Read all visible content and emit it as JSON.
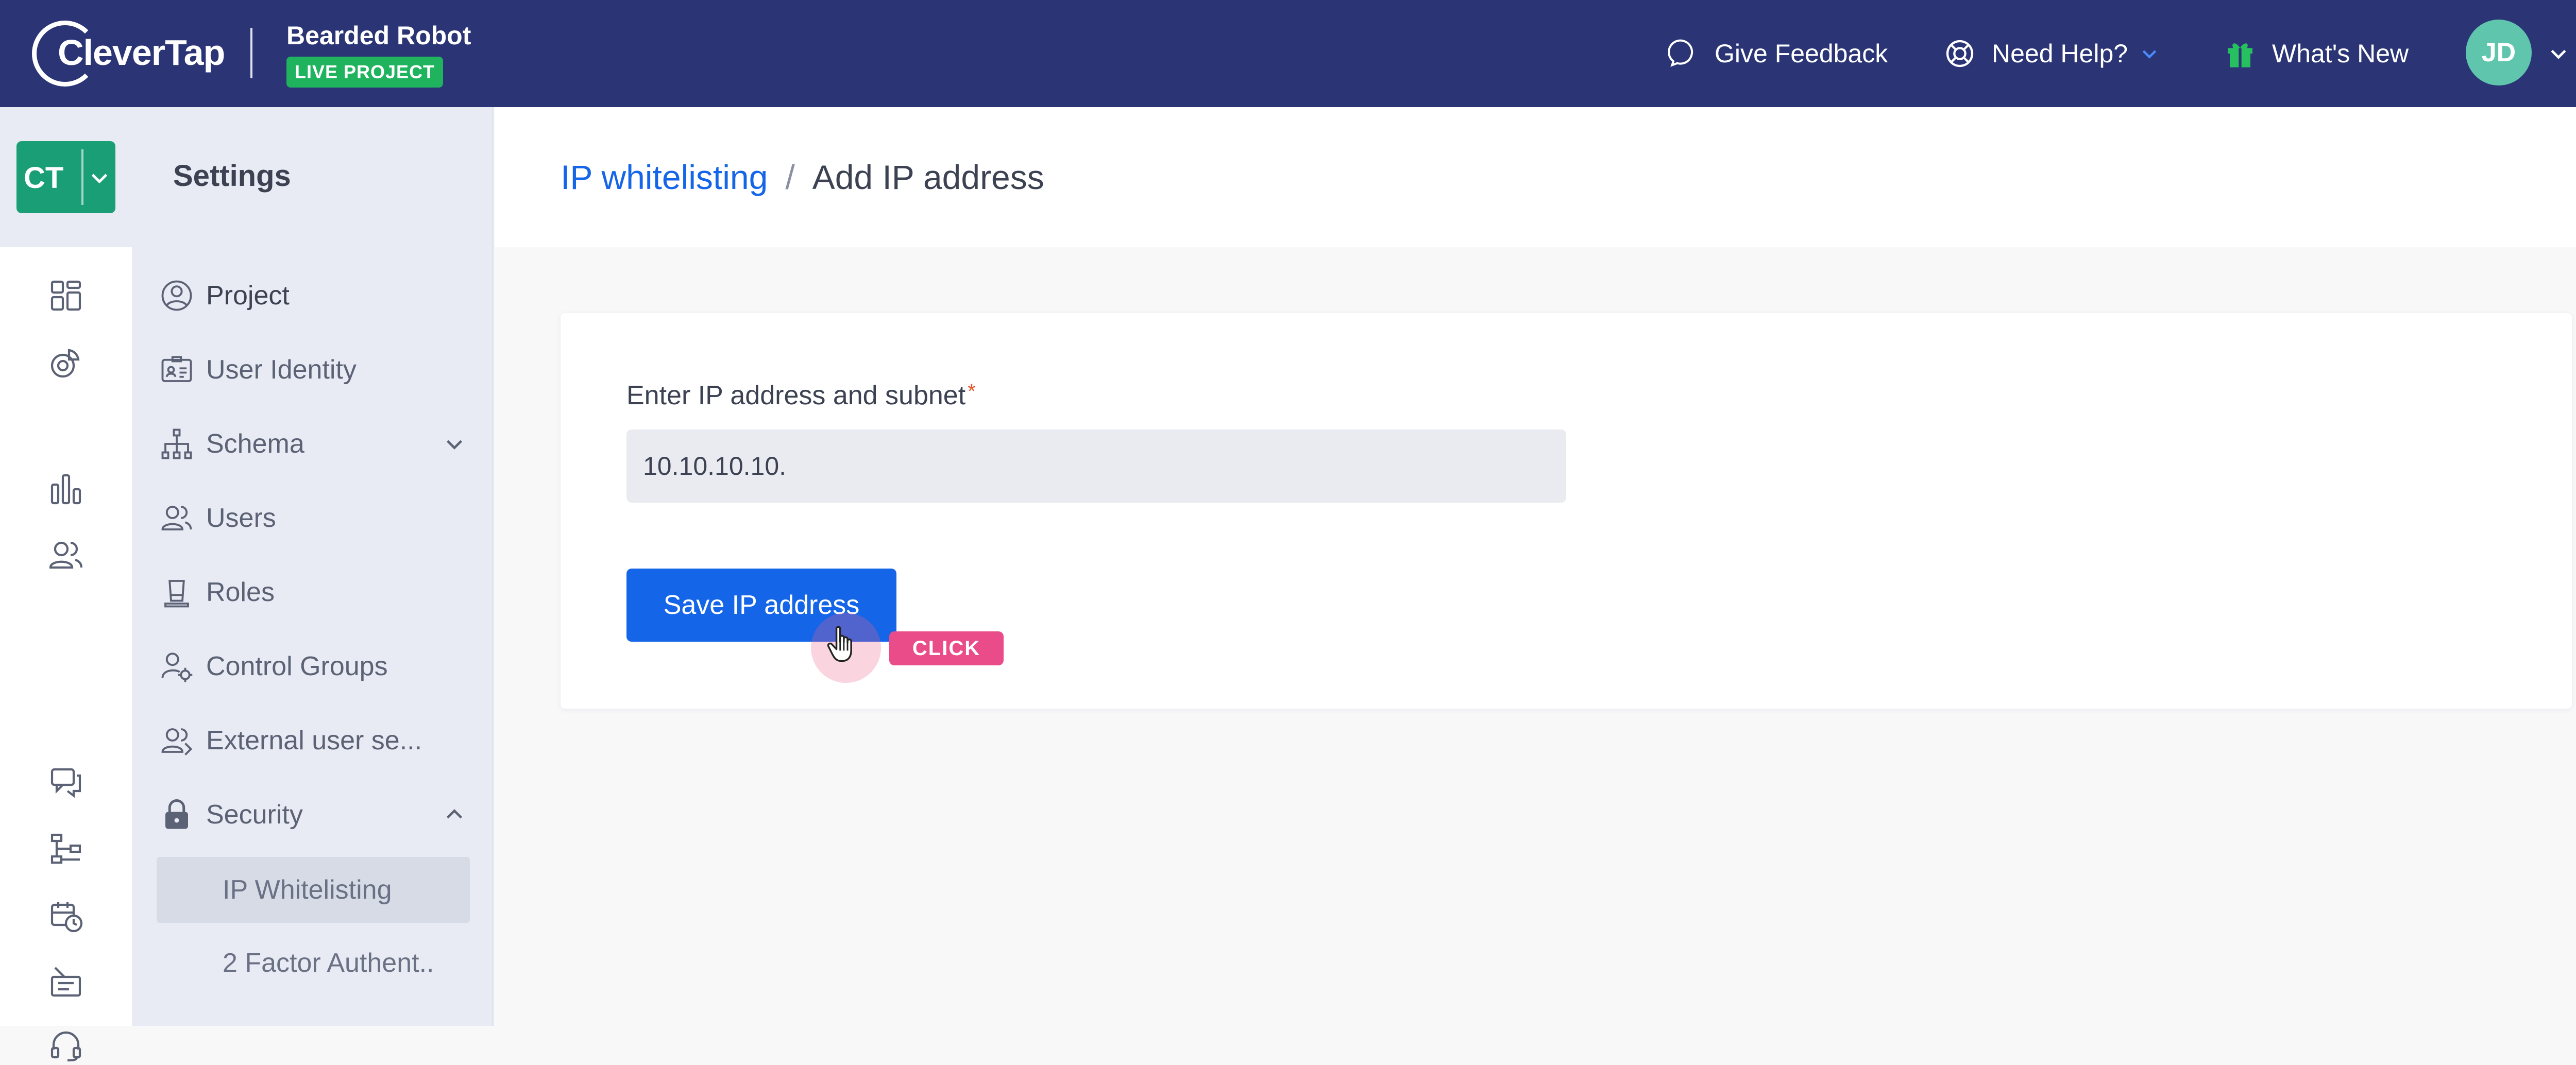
{
  "header": {
    "brand": "CleverTap",
    "project_name": "Bearded Robot",
    "project_badge": "LIVE PROJECT",
    "give_feedback": "Give Feedback",
    "need_help": "Need Help?",
    "whats_new": "What's New",
    "avatar_initials": "JD"
  },
  "rail": {
    "account_short": "CT",
    "icons": [
      "dashboard-icon",
      "segments-icon",
      "analytics-icon",
      "users-icon",
      "messages-icon",
      "journeys-icon",
      "schedule-icon",
      "catalog-icon",
      "support-icon"
    ]
  },
  "sidebar": {
    "title": "Settings",
    "items": [
      {
        "label": "Project",
        "icon": "user-circle-icon"
      },
      {
        "label": "User Identity",
        "icon": "id-card-icon"
      },
      {
        "label": "Schema",
        "icon": "schema-icon"
      },
      {
        "label": "Users",
        "icon": "users-icon"
      },
      {
        "label": "Roles",
        "icon": "hat-icon"
      },
      {
        "label": "Control Groups",
        "icon": "user-gear-icon"
      },
      {
        "label": "External user se...",
        "icon": "external-users-icon"
      },
      {
        "label": "Security",
        "icon": "lock-icon"
      }
    ],
    "security_subitems": [
      {
        "label": "IP Whitelisting",
        "selected": true
      },
      {
        "label": "2 Factor Authent..",
        "selected": false
      }
    ]
  },
  "breadcrumb": {
    "parent": "IP whitelisting",
    "separator": "/",
    "current": "Add IP address"
  },
  "form": {
    "field_label": "Enter IP address and subnet",
    "required_mark": "*",
    "ip_value": "10.10.10.10.",
    "save_label": "Save IP address"
  },
  "overlay": {
    "click_label": "CLICK"
  },
  "colors": {
    "topbar": "#2b3576",
    "primary": "#1565e8",
    "live_badge": "#1fb35e",
    "ct_button": "#1a9e75",
    "avatar": "#5fc5ad",
    "click_badge": "#ea4c89"
  }
}
